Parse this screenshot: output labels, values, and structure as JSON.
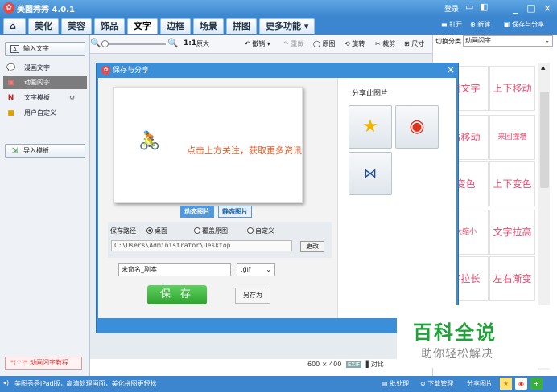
{
  "app": {
    "title": "美图秀秀 4.0.1"
  },
  "titlebar_links": {
    "login": "登录",
    "msg_icon": "message-icon",
    "skin_icon": "skin-icon",
    "min": "_",
    "max": "□",
    "close": "×"
  },
  "tabs": [
    {
      "label": "美化"
    },
    {
      "label": "美容"
    },
    {
      "label": "饰品"
    },
    {
      "label": "文字"
    },
    {
      "label": "边框"
    },
    {
      "label": "场景"
    },
    {
      "label": "拼图"
    },
    {
      "label": "更多功能"
    }
  ],
  "top_right": {
    "open": "打开",
    "new": "新建",
    "save_share": "保存与分享"
  },
  "toolbar": {
    "zoom_orig": "1:1",
    "zoom_orig_label": "原大",
    "undo": "撤销",
    "redo": "重做",
    "original": "原图",
    "rotate": "旋转",
    "crop": "裁剪",
    "size": "尺寸"
  },
  "sidebar": {
    "input_text": "输入文字",
    "items": [
      {
        "label": "漫画文字"
      },
      {
        "label": "动画闪字"
      },
      {
        "label": "文字模板"
      },
      {
        "label": "用户自定义"
      }
    ],
    "import_template": "导入模板",
    "tutorial": "动画闪字教程"
  },
  "right_panel": {
    "category_label": "切换分类",
    "category_value": "动画闪字",
    "cells": [
      "闪文字",
      "上下移动",
      "右移动",
      "来回撞墙",
      "变色",
      "上下变色",
      "大缩小",
      "文字拉高",
      "字拉长",
      "左右渐变"
    ]
  },
  "dialog": {
    "title": "保存与分享",
    "promo_text": "点击上方关注，获取更多资讯",
    "mode_dynamic": "动态图片",
    "mode_static": "静态图片",
    "path_label": "保存路径",
    "opt_desktop": "桌面",
    "opt_overwrite": "覆盖原图",
    "opt_custom": "自定义",
    "path_value": "C:\\Users\\Administrator\\Desktop",
    "change_btn": "更改",
    "file_name": "未命名_副本",
    "file_format": ".gif",
    "save_btn": "保 存",
    "save_as_btn": "另存为",
    "share_label": "分享此图片"
  },
  "canvas_info": {
    "size": "600 × 400",
    "exif": "EXIF",
    "compare": "对比"
  },
  "statusbar": {
    "left": "美图秀秀iPad版，高清处理画面，美化拼图更轻松",
    "batch": "批处理",
    "download": "下载管理",
    "share": "分享图片"
  },
  "watermark": {
    "line1": "百科全说",
    "line2": "助你轻松解决"
  },
  "colors": {
    "accent": "#3b86cf",
    "save_green": "#2fa12f",
    "promo": "#ee5a24",
    "watermark_green": "#1fa23a"
  }
}
